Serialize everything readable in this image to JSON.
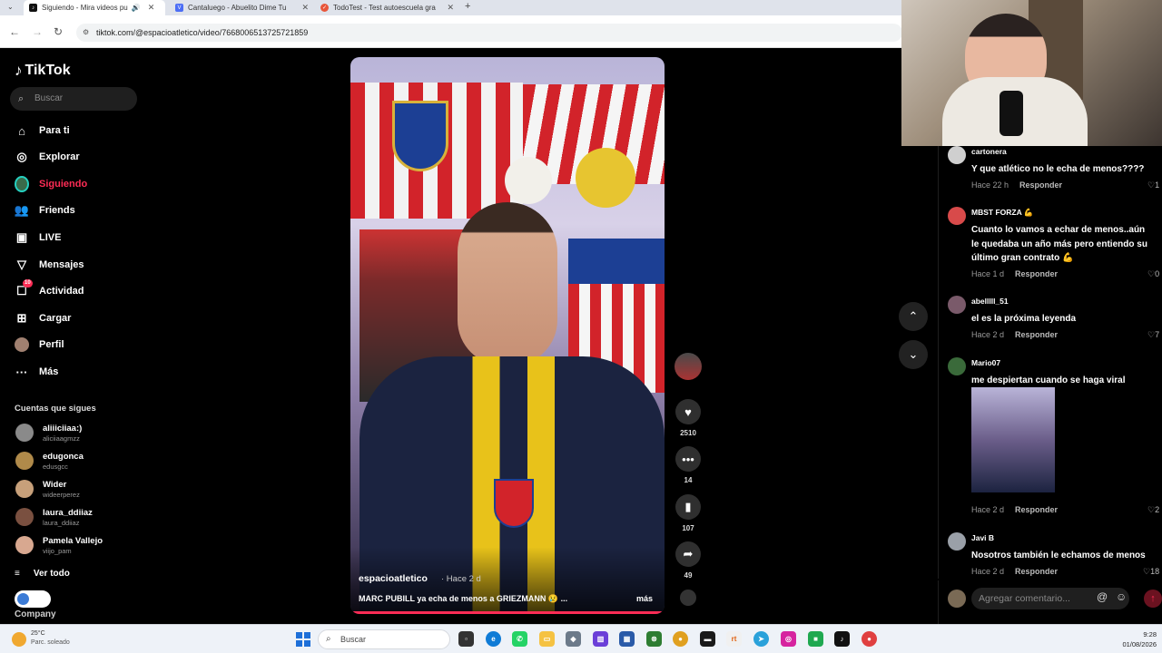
{
  "browser": {
    "tabs": [
      {
        "title": "Siguiendo - Mira videos pu",
        "favicon_color": "#111111"
      },
      {
        "title": "Cantaluego - Abuelito Dime Tu",
        "favicon_color": "#4c6ef5"
      },
      {
        "title": "TodoTest - Test autoescuela gra",
        "favicon_color": "#e8563a"
      }
    ],
    "url": "tiktok.com/@espacioatletico/video/7668006513725721859"
  },
  "sidebar": {
    "logo": "TikTok",
    "search_placeholder": "Buscar",
    "nav": [
      {
        "label": "Para ti",
        "icon": "home-icon"
      },
      {
        "label": "Explorar",
        "icon": "compass-icon"
      },
      {
        "label": "Siguiendo",
        "icon": "following-avatar-icon",
        "active": true
      },
      {
        "label": "Friends",
        "icon": "friends-icon"
      },
      {
        "label": "LIVE",
        "icon": "live-icon"
      },
      {
        "label": "Mensajes",
        "icon": "send-icon"
      },
      {
        "label": "Actividad",
        "icon": "activity-icon",
        "badge": "10"
      },
      {
        "label": "Cargar",
        "icon": "plus-square-icon"
      },
      {
        "label": "Perfil",
        "icon": "profile-avatar-icon"
      },
      {
        "label": "Más",
        "icon": "more-icon"
      }
    ],
    "following_title": "Cuentas que sigues",
    "accounts": [
      {
        "name": "aliiiciiaa:)",
        "handle": "aliciiaagmzz",
        "color": "#8a8a8a"
      },
      {
        "name": "edugonca",
        "handle": "edusgcc",
        "color": "#b08a4a"
      },
      {
        "name": "Wider",
        "handle": "wideerperez",
        "color": "#c7a07a"
      },
      {
        "name": "laura_ddiiaz",
        "handle": "laura_ddiiaz",
        "color": "#7a5040"
      },
      {
        "name": "Pamela Vallejo",
        "handle": "viijo_pam",
        "color": "#d8a890"
      }
    ],
    "see_all": "Ver todo",
    "company": "Company"
  },
  "video": {
    "username": "espacioatletico",
    "time": "· Hace 2 d",
    "caption": "MARC PUBILL ya echa de menos a GRIEZMANN 😢 ...",
    "more": "más"
  },
  "actions": {
    "likes": "2510",
    "comments": "14",
    "saves": "107",
    "shares": "49"
  },
  "comments": [
    {
      "user": "cartonera",
      "text": "Y que atlético no le echa de menos????",
      "time": "Hace 22 h",
      "reply": "Responder",
      "likes": "1",
      "color": "#cfcfcf"
    },
    {
      "user": "MBST FORZA 💪",
      "text": "Cuanto lo vamos a echar de menos..aún le quedaba un año más pero entiendo su último gran contrato 💪",
      "time": "Hace 1 d",
      "reply": "Responder",
      "likes": "0",
      "color": "#d84a4a"
    },
    {
      "user": "abelllll_51",
      "text": "el es la próxima leyenda",
      "time": "Hace 2 d",
      "reply": "Responder",
      "likes": "7",
      "color": "#7a5a6a"
    },
    {
      "user": "Mario07",
      "text": "me despiertan cuando se haga viral",
      "time": "Hace 2 d",
      "reply": "Responder",
      "likes": "2",
      "color": "#3a6a3a"
    },
    {
      "user": "Javi B",
      "text": "Nosotros también le echamos de menos",
      "time": "Hace 2 d",
      "reply": "Responder",
      "likes": "18",
      "color": "#9aa0a8"
    }
  ],
  "comment_input": {
    "placeholder": "Agregar comentario..."
  },
  "taskbar": {
    "temperature": "25°C",
    "weather": "Parc. soleado",
    "search": "Buscar",
    "time": "9:28",
    "date": "01/08/2026"
  }
}
